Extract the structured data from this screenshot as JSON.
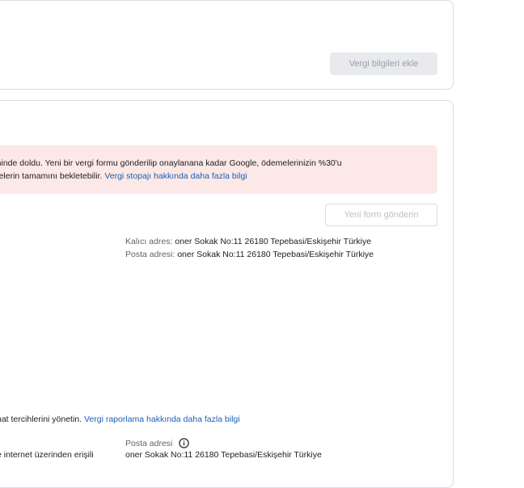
{
  "tax_info": {
    "add_button_label": "Vergi bilgileri ekle"
  },
  "tax_form": {
    "alert": {
      "line1": "arihinde doldu. Yeni bir vergi formu gönderilip onaylanana kadar Google, ödemelerinizin %30'u",
      "line2": "emelerin tamamını bekletebilir.",
      "link": "Vergi stopajı hakkında daha fazla bilgi"
    },
    "new_form_button_label": "Yeni form gönderin",
    "permanent_address_label": "Kalıcı adres:",
    "permanent_address_value": "oner Sokak No:11 26180 Tepebasi/Eskişehir Türkiye",
    "mailing_address_label": "Posta adresi:",
    "mailing_address_value": "oner Sokak No:11 26180 Tepebasi/Eskişehir Türkiye"
  },
  "tax_reporting": {
    "text": "nat tercihlerini yönetin.",
    "link": "Vergi raporlama hakkında daha fazla bilgi",
    "postal_address_label": "Posta adresi",
    "cut_left_text": "e internet üzerinden erişili",
    "cut_right_text": "oner Sokak No:11 26180 Tepebasi/Eskişehir Türkiye"
  },
  "icons": {
    "info": "info-icon"
  },
  "colors": {
    "alert_background": "#fce8e6",
    "link": "#1a5fb4",
    "disabled_button": "#e8eaed"
  }
}
